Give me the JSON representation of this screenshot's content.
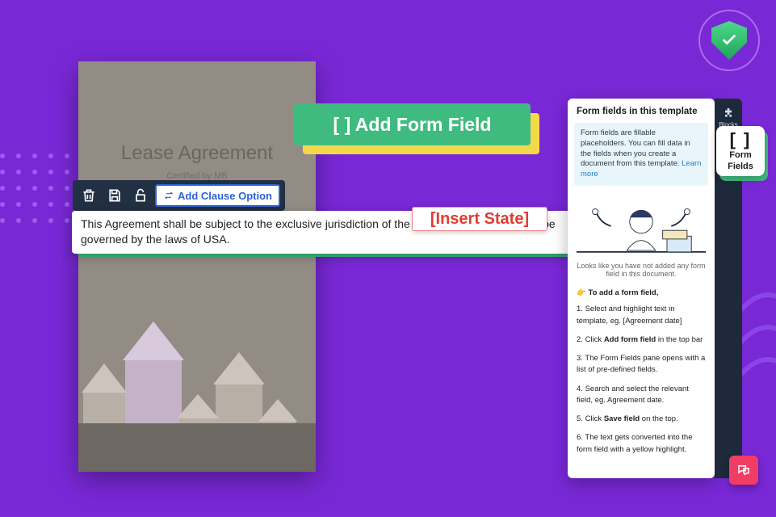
{
  "shield": {
    "icon": "shield-check"
  },
  "document": {
    "title": "Lease Agreement",
    "certified_by": "Certified by MB"
  },
  "callout": {
    "add_form_field": "[ ] Add Form Field"
  },
  "toolbar": {
    "icons": {
      "delete": "delete-icon",
      "save": "save-icon",
      "lock": "lock-icon"
    },
    "add_clause": "Add Clause Option"
  },
  "clause": {
    "text_before": "This Agreement shall be subject to the exclusive jurisdiction of the ",
    "state_gap": "                                ",
    "text_after": " shall be governed by the laws of USA.",
    "insert_state": "[Insert State]"
  },
  "panel": {
    "heading": "Form fields in this template",
    "info": "Form fields are fillable placeholders. You can fill data in the fields when you create a document from this template. ",
    "learn_more": "Learn more",
    "empty": "Looks like you have not added any form field in this document.",
    "add_lead": "👉 To add a form field,",
    "steps": [
      {
        "n": "1.",
        "pre": "Select and highlight text in template, eg. [Agreement date]",
        "b": "",
        "post": ""
      },
      {
        "n": "2.",
        "pre": "Click ",
        "b": "Add form field",
        "post": " in the top bar"
      },
      {
        "n": "3.",
        "pre": "The Form Fields pane opens with a list of pre-defined fields.",
        "b": "",
        "post": ""
      },
      {
        "n": "4.",
        "pre": "Search and select the relevant field, eg. Agreement date.",
        "b": "",
        "post": ""
      },
      {
        "n": "5.",
        "pre": "Click ",
        "b": "Save field",
        "post": " on the top."
      },
      {
        "n": "6.",
        "pre": "The text gets converted into the form field with a yellow highlight.",
        "b": "",
        "post": ""
      }
    ]
  },
  "rail": {
    "blocks": "Blocks",
    "form_fields": "Form Fields"
  },
  "pill": {
    "label1": "Form",
    "label2": "Fields"
  },
  "chat": {
    "label": "chat"
  }
}
